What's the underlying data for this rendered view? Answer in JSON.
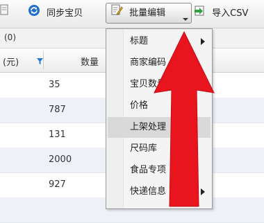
{
  "toolbar": {
    "prev_label": "",
    "sync_label": "同步宝贝",
    "batch_label": "批量编辑",
    "csv_label": "导入CSV"
  },
  "tabstrip": {
    "count_label": "(0)"
  },
  "table": {
    "headers": {
      "price": "(元)",
      "quantity": "数量"
    },
    "rows": [
      "35",
      "787",
      "131",
      "2000",
      "927",
      ""
    ]
  },
  "menu": {
    "items": [
      {
        "label": "标题",
        "submenu": true
      },
      {
        "label": "商家编码",
        "submenu": false
      },
      {
        "label": "宝贝数量",
        "submenu": false
      },
      {
        "label": "价格",
        "submenu": false
      },
      {
        "label": "上架处理",
        "submenu": false,
        "highlighted": true
      },
      {
        "label": "尺码库",
        "submenu": false
      },
      {
        "label": "食品专项",
        "submenu": false
      },
      {
        "label": "快递信息",
        "submenu": true
      }
    ]
  },
  "colors": {
    "annotation_arrow": "#e8141e",
    "row_alt": "#eef2f8",
    "menu_highlight": "#d9d9d9"
  },
  "icons": [
    "doc-icon",
    "sync-icon",
    "edit-icon",
    "import-icon",
    "filter-icon"
  ]
}
